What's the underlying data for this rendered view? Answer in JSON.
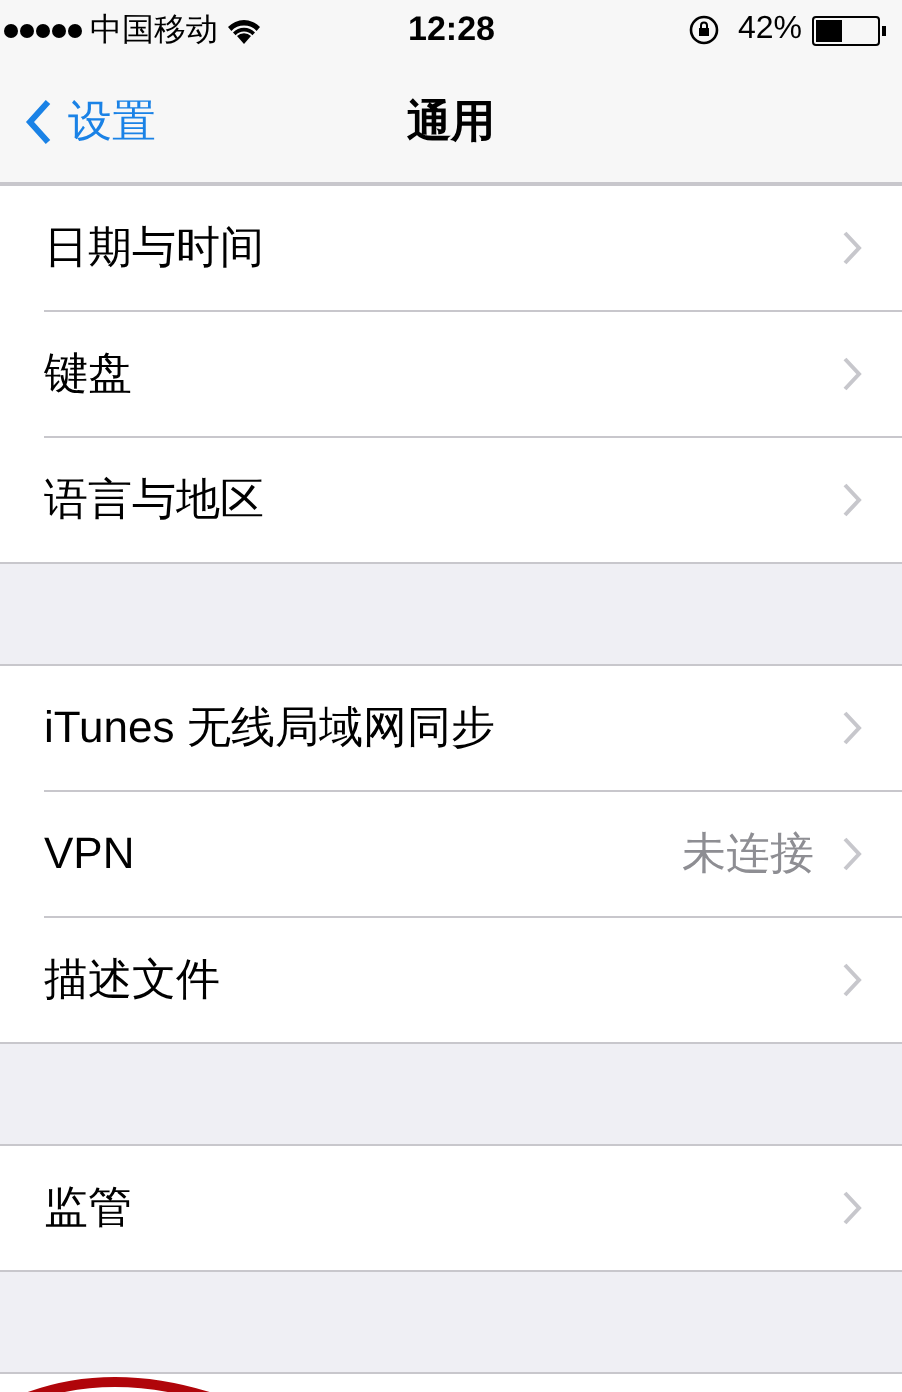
{
  "status_bar": {
    "carrier": "中国移动",
    "time": "12:28",
    "battery": "42%"
  },
  "nav": {
    "back": "设置",
    "title": "通用"
  },
  "groups": [
    {
      "rows": [
        {
          "label": "日期与时间"
        },
        {
          "label": "键盘"
        },
        {
          "label": "语言与地区"
        }
      ]
    },
    {
      "rows": [
        {
          "label": "iTunes 无线局域网同步"
        },
        {
          "label": "VPN",
          "value": "未连接"
        },
        {
          "label": "描述文件"
        }
      ]
    },
    {
      "rows": [
        {
          "label": "监管"
        }
      ]
    }
  ]
}
